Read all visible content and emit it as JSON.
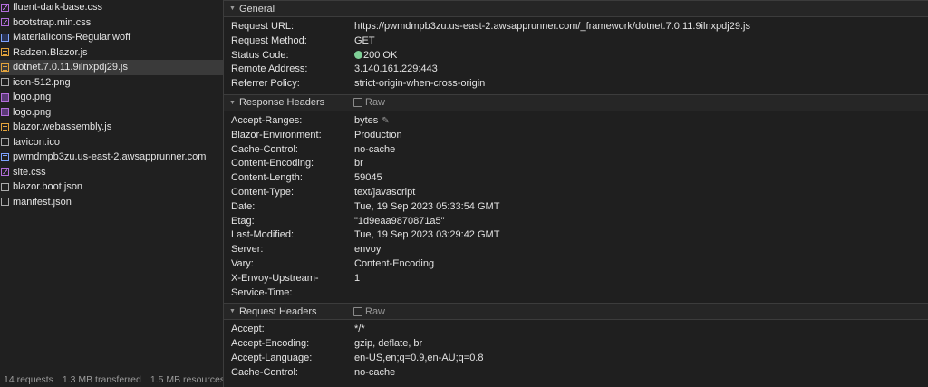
{
  "files": [
    {
      "name": "fluent-dark-base.css",
      "icon": "css-file-icon"
    },
    {
      "name": "bootstrap.min.css",
      "icon": "css-file-icon"
    },
    {
      "name": "MaterialIcons-Regular.woff",
      "icon": "font-file-icon"
    },
    {
      "name": "Radzen.Blazor.js",
      "icon": "js-file-icon"
    },
    {
      "name": "dotnet.7.0.11.9ilnxpdj29.js",
      "icon": "js-file-icon",
      "selected": true
    },
    {
      "name": "icon-512.png",
      "icon": "file-icon"
    },
    {
      "name": "logo.png",
      "icon": "image-file-icon"
    },
    {
      "name": "logo.png",
      "icon": "image-file-icon"
    },
    {
      "name": "blazor.webassembly.js",
      "icon": "js-file-icon"
    },
    {
      "name": "favicon.ico",
      "icon": "file-icon"
    },
    {
      "name": "pwmdmpb3zu.us-east-2.awsapprunner.com",
      "icon": "document-file-icon"
    },
    {
      "name": "site.css",
      "icon": "css-file-icon"
    },
    {
      "name": "blazor.boot.json",
      "icon": "file-icon"
    },
    {
      "name": "manifest.json",
      "icon": "file-icon"
    }
  ],
  "status_bar": {
    "requests": "14 requests",
    "transferred": "1.3 MB transferred",
    "resources": "1.5 MB resources"
  },
  "general": {
    "title": "General",
    "rows": [
      {
        "k": "Request URL:",
        "v": "https://pwmdmpb3zu.us-east-2.awsapprunner.com/_framework/dotnet.7.0.11.9ilnxpdj29.js"
      },
      {
        "k": "Request Method:",
        "v": "GET"
      },
      {
        "k": "Status Code:",
        "v": "200 OK",
        "dot": true
      },
      {
        "k": "Remote Address:",
        "v": "3.140.161.229:443"
      },
      {
        "k": "Referrer Policy:",
        "v": "strict-origin-when-cross-origin"
      }
    ],
    "status_color": "#7fcf97"
  },
  "response_headers": {
    "title": "Response Headers",
    "raw_label": "Raw",
    "rows": [
      {
        "k": "Accept-Ranges:",
        "v": "bytes",
        "edit": true
      },
      {
        "k": "Blazor-Environment:",
        "v": "Production"
      },
      {
        "k": "Cache-Control:",
        "v": "no-cache"
      },
      {
        "k": "Content-Encoding:",
        "v": "br"
      },
      {
        "k": "Content-Length:",
        "v": "59045"
      },
      {
        "k": "Content-Type:",
        "v": "text/javascript"
      },
      {
        "k": "Date:",
        "v": "Tue, 19 Sep 2023 05:33:54 GMT"
      },
      {
        "k": "Etag:",
        "v": "\"1d9eaa9870871a5\""
      },
      {
        "k": "Last-Modified:",
        "v": "Tue, 19 Sep 2023 03:29:42 GMT"
      },
      {
        "k": "Server:",
        "v": "envoy"
      },
      {
        "k": "Vary:",
        "v": "Content-Encoding"
      },
      {
        "k": "X-Envoy-Upstream-Service-Time:",
        "v": "1",
        "wrap": true
      }
    ]
  },
  "request_headers": {
    "title": "Request Headers",
    "raw_label": "Raw",
    "rows": [
      {
        "k": "Accept:",
        "v": "*/*"
      },
      {
        "k": "Accept-Encoding:",
        "v": "gzip, deflate, br"
      },
      {
        "k": "Accept-Language:",
        "v": "en-US,en;q=0.9,en-AU;q=0.8"
      },
      {
        "k": "Cache-Control:",
        "v": "no-cache"
      }
    ]
  }
}
